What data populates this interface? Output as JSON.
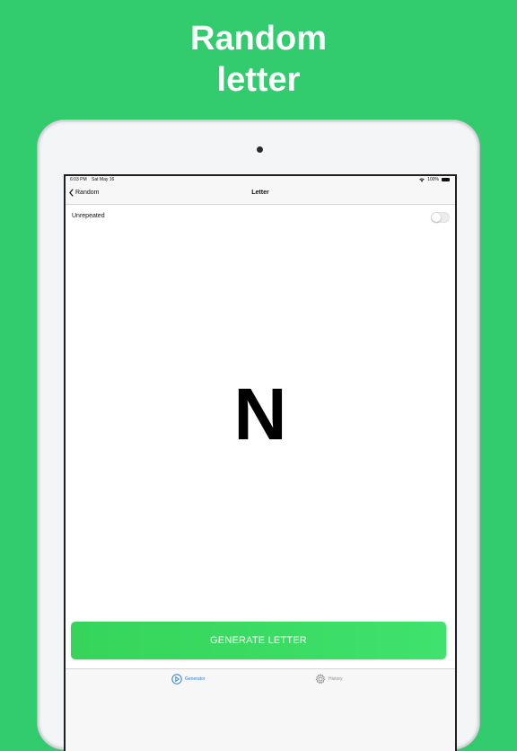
{
  "headline": {
    "line1": "Random",
    "line2": "letter"
  },
  "status_bar": {
    "time": "6:03 PM",
    "date": "Sat May 16",
    "battery": "100%"
  },
  "nav": {
    "back_label": "Random",
    "title": "Letter"
  },
  "option": {
    "label": "Unrepeated",
    "toggle_on": false
  },
  "result": {
    "letter": "N"
  },
  "generate_button": {
    "label": "GENERATE LETTER"
  },
  "tabs": [
    {
      "label": "Generator",
      "icon": "play-circle-icon",
      "selected": true
    },
    {
      "label": "History",
      "icon": "gear-icon",
      "selected": false
    }
  ],
  "colors": {
    "background": "#32cc6e",
    "button": "#3ddc62",
    "tab_selected": "#2f7fd0",
    "tab_unselected": "#8e8e93"
  }
}
